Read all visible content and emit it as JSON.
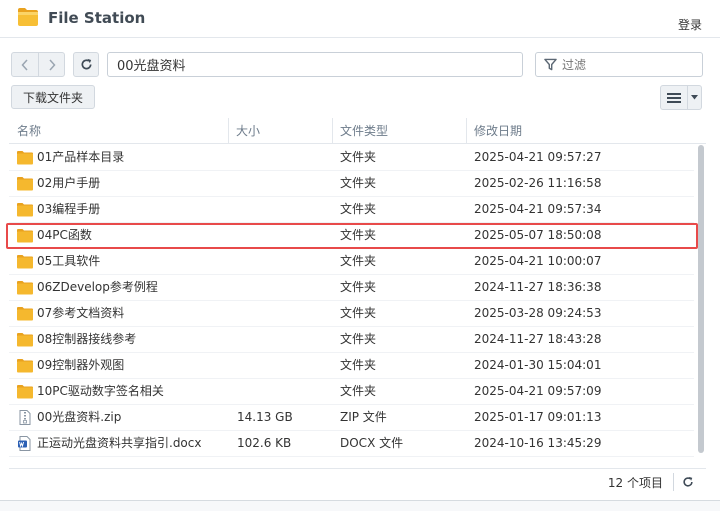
{
  "app": {
    "title": "File Station",
    "login_label": "登录"
  },
  "toolbar": {
    "path_value": "00光盘资料",
    "filter_placeholder": "过滤",
    "download_label": "下载文件夹"
  },
  "columns": {
    "name": "名称",
    "size": "大小",
    "type": "文件类型",
    "modified": "修改日期"
  },
  "files": [
    {
      "name": "01产品样本目录",
      "size": "",
      "type": "文件夹",
      "modified": "2025-04-21 09:57:27",
      "icon": "folder-icon"
    },
    {
      "name": "02用户手册",
      "size": "",
      "type": "文件夹",
      "modified": "2025-02-26 11:16:58",
      "icon": "folder-icon"
    },
    {
      "name": "03编程手册",
      "size": "",
      "type": "文件夹",
      "modified": "2025-04-21 09:57:34",
      "icon": "folder-icon"
    },
    {
      "name": "04PC函数",
      "size": "",
      "type": "文件夹",
      "modified": "2025-05-07 18:50:08",
      "icon": "folder-icon"
    },
    {
      "name": "05工具软件",
      "size": "",
      "type": "文件夹",
      "modified": "2025-04-21 10:00:07",
      "icon": "folder-icon"
    },
    {
      "name": "06ZDevelop参考例程",
      "size": "",
      "type": "文件夹",
      "modified": "2024-11-27 18:36:38",
      "icon": "folder-icon"
    },
    {
      "name": "07参考文档资料",
      "size": "",
      "type": "文件夹",
      "modified": "2025-03-28 09:24:53",
      "icon": "folder-icon"
    },
    {
      "name": "08控制器接线参考",
      "size": "",
      "type": "文件夹",
      "modified": "2024-11-27 18:43:28",
      "icon": "folder-icon"
    },
    {
      "name": "09控制器外观图",
      "size": "",
      "type": "文件夹",
      "modified": "2024-01-30 15:04:01",
      "icon": "folder-icon"
    },
    {
      "name": "10PC驱动数字签名相关",
      "size": "",
      "type": "文件夹",
      "modified": "2025-04-21 09:57:09",
      "icon": "folder-icon"
    },
    {
      "name": "00光盘资料.zip",
      "size": "14.13 GB",
      "type": "ZIP 文件",
      "modified": "2025-01-17 09:01:13",
      "icon": "zip-file-icon"
    },
    {
      "name": "正运动光盘资料共享指引.docx",
      "size": "102.6 KB",
      "type": "DOCX 文件",
      "modified": "2024-10-16 13:45:29",
      "icon": "word-file-icon"
    }
  ],
  "footer": {
    "item_count": "12 个项目"
  },
  "colors": {
    "folder": "#f5b82e",
    "highlight": "#e84a4a"
  }
}
